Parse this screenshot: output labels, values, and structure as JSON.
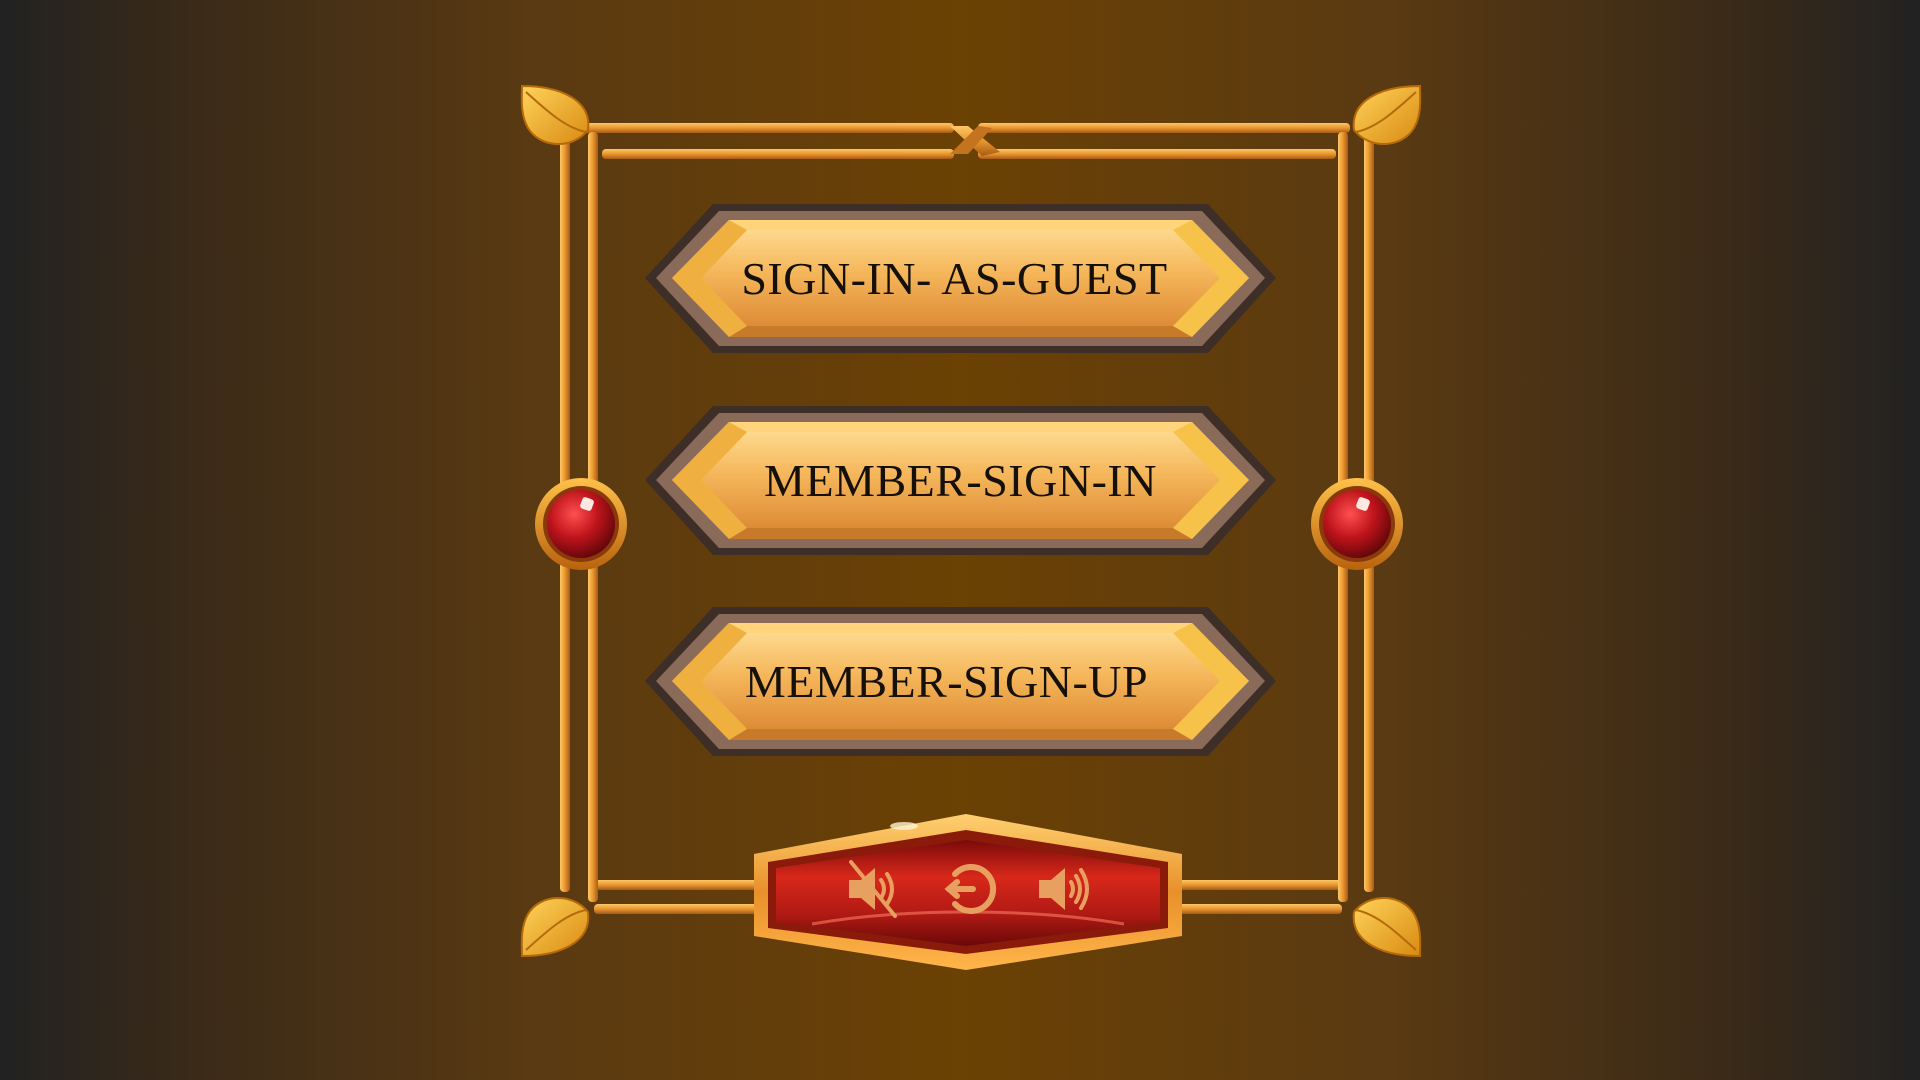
{
  "menu": {
    "guest_label": "SIGN-IN- AS-GUEST",
    "member_signin_label": "MEMBER-SIGN-IN",
    "member_signup_label": "MEMBER-SIGN-UP"
  },
  "controls": {
    "mute_icon": "speaker-muted-icon",
    "exit_icon": "power-exit-icon",
    "sound_icon": "speaker-sound-icon"
  },
  "colors": {
    "background": "#6b4104",
    "frame_gold": "#e39a3a",
    "button_gold": "#f2b558",
    "button_border": "#4a3a30",
    "gem_red": "#c0141c",
    "control_red": "#b01a14"
  }
}
